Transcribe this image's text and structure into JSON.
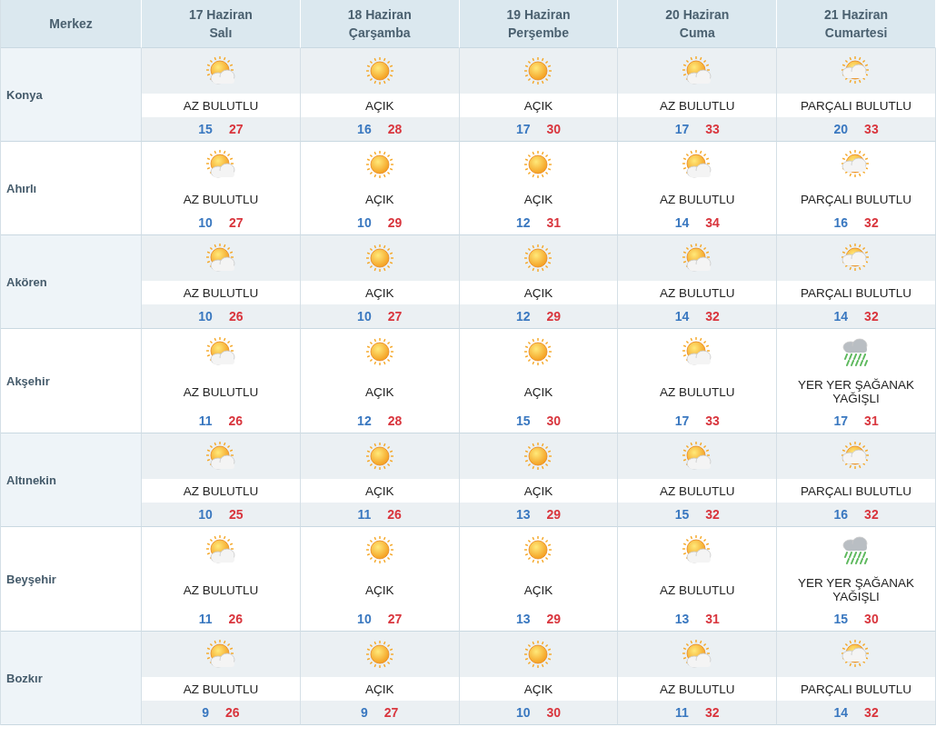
{
  "header": {
    "station_label": "Merkez",
    "days": [
      {
        "date": "17 Haziran",
        "weekday": "Salı"
      },
      {
        "date": "18 Haziran",
        "weekday": "Çarşamba"
      },
      {
        "date": "19 Haziran",
        "weekday": "Perşembe"
      },
      {
        "date": "20 Haziran",
        "weekday": "Cuma"
      },
      {
        "date": "21 Haziran",
        "weekday": "Cumartesi"
      }
    ]
  },
  "rows": [
    {
      "city": "Konya",
      "forecasts": [
        {
          "kind": "partly",
          "condition": "AZ BULUTLU",
          "min": "15",
          "max": "27"
        },
        {
          "kind": "sun",
          "condition": "AÇIK",
          "min": "16",
          "max": "28"
        },
        {
          "kind": "sun",
          "condition": "AÇIK",
          "min": "17",
          "max": "30"
        },
        {
          "kind": "partly",
          "condition": "AZ BULUTLU",
          "min": "17",
          "max": "33"
        },
        {
          "kind": "cloudy",
          "condition": "PARÇALI BULUTLU",
          "min": "20",
          "max": "33"
        }
      ]
    },
    {
      "city": "Ahırlı",
      "forecasts": [
        {
          "kind": "partly",
          "condition": "AZ BULUTLU",
          "min": "10",
          "max": "27"
        },
        {
          "kind": "sun",
          "condition": "AÇIK",
          "min": "10",
          "max": "29"
        },
        {
          "kind": "sun",
          "condition": "AÇIK",
          "min": "12",
          "max": "31"
        },
        {
          "kind": "partly",
          "condition": "AZ BULUTLU",
          "min": "14",
          "max": "34"
        },
        {
          "kind": "cloudy",
          "condition": "PARÇALI BULUTLU",
          "min": "16",
          "max": "32"
        }
      ]
    },
    {
      "city": "Akören",
      "forecasts": [
        {
          "kind": "partly",
          "condition": "AZ BULUTLU",
          "min": "10",
          "max": "26"
        },
        {
          "kind": "sun",
          "condition": "AÇIK",
          "min": "10",
          "max": "27"
        },
        {
          "kind": "sun",
          "condition": "AÇIK",
          "min": "12",
          "max": "29"
        },
        {
          "kind": "partly",
          "condition": "AZ BULUTLU",
          "min": "14",
          "max": "32"
        },
        {
          "kind": "cloudy",
          "condition": "PARÇALI BULUTLU",
          "min": "14",
          "max": "32"
        }
      ]
    },
    {
      "city": "Akşehir",
      "forecasts": [
        {
          "kind": "partly",
          "condition": "AZ BULUTLU",
          "min": "11",
          "max": "26"
        },
        {
          "kind": "sun",
          "condition": "AÇIK",
          "min": "12",
          "max": "28"
        },
        {
          "kind": "sun",
          "condition": "AÇIK",
          "min": "15",
          "max": "30"
        },
        {
          "kind": "partly",
          "condition": "AZ BULUTLU",
          "min": "17",
          "max": "33"
        },
        {
          "kind": "rain",
          "condition": "YER YER ŞAĞANAK YAĞIŞLI",
          "min": "17",
          "max": "31"
        }
      ]
    },
    {
      "city": "Altınekin",
      "forecasts": [
        {
          "kind": "partly",
          "condition": "AZ BULUTLU",
          "min": "10",
          "max": "25"
        },
        {
          "kind": "sun",
          "condition": "AÇIK",
          "min": "11",
          "max": "26"
        },
        {
          "kind": "sun",
          "condition": "AÇIK",
          "min": "13",
          "max": "29"
        },
        {
          "kind": "partly",
          "condition": "AZ BULUTLU",
          "min": "15",
          "max": "32"
        },
        {
          "kind": "cloudy",
          "condition": "PARÇALI BULUTLU",
          "min": "16",
          "max": "32"
        }
      ]
    },
    {
      "city": "Beyşehir",
      "forecasts": [
        {
          "kind": "partly",
          "condition": "AZ BULUTLU",
          "min": "11",
          "max": "26"
        },
        {
          "kind": "sun",
          "condition": "AÇIK",
          "min": "10",
          "max": "27"
        },
        {
          "kind": "sun",
          "condition": "AÇIK",
          "min": "13",
          "max": "29"
        },
        {
          "kind": "partly",
          "condition": "AZ BULUTLU",
          "min": "13",
          "max": "31"
        },
        {
          "kind": "rain",
          "condition": "YER YER ŞAĞANAK YAĞIŞLI",
          "min": "15",
          "max": "30"
        }
      ]
    },
    {
      "city": "Bozkır",
      "forecasts": [
        {
          "kind": "partly",
          "condition": "AZ BULUTLU",
          "min": "9",
          "max": "26"
        },
        {
          "kind": "sun",
          "condition": "AÇIK",
          "min": "9",
          "max": "27"
        },
        {
          "kind": "sun",
          "condition": "AÇIK",
          "min": "10",
          "max": "30"
        },
        {
          "kind": "partly",
          "condition": "AZ BULUTLU",
          "min": "11",
          "max": "32"
        },
        {
          "kind": "cloudy",
          "condition": "PARÇALI BULUTLU",
          "min": "14",
          "max": "32"
        }
      ]
    }
  ]
}
